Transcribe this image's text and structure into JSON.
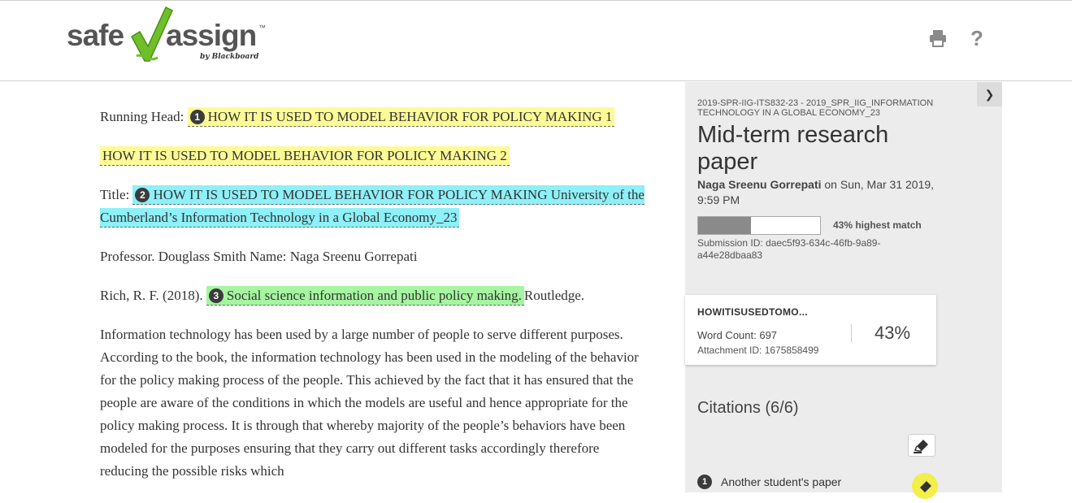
{
  "header": {
    "logo_text_left": "safe",
    "logo_text_right": "assign",
    "logo_tm": "™",
    "logo_sub": "by Blackboard",
    "print_icon": "printer-icon",
    "help_label": "?"
  },
  "document": {
    "line1_prefix": "Running Head:",
    "line1_num": "1",
    "line1_highlight": "HOW IT IS USED TO MODEL BEHAVIOR FOR POLICY MAKING 1",
    "line2_highlight": "HOW IT IS USED TO MODEL BEHAVIOR FOR POLICY MAKING 2",
    "line3_prefix": "Title:",
    "line3_num": "2",
    "line3_highlight": "HOW IT IS USED TO MODEL BEHAVIOR FOR POLICY MAKING University of the Cumberland’s Information Technology in a Global Economy_23",
    "line4": "Professor. Douglass Smith Name: Naga Sreenu Gorrepati",
    "line5_prefix": "Rich, R. F. (2018).",
    "line5_num": "3",
    "line5_highlight": "Social science information and public policy making.",
    "line5_suffix": "Routledge.",
    "body": "Information technology has been used by a large number of people to serve different purposes. According to the book, the information technology has been used in the modeling of the behavior for the policy making process of the people. This achieved by the fact that it has ensured that the people are aware of the conditions in which the models are useful and hence appropriate for the policy making process. It is through that whereby majority of the people’s behaviors have been modeled for the purposes ensuring that they carry out different tasks accordingly therefore reducing the possible risks which"
  },
  "panel": {
    "toggle_icon": "chevron-right-icon",
    "course": "2019-SPR-IIG-ITS832-23 - 2019_SPR_IIG_INFORMATION TECHNOLOGY IN A GLOBAL ECONOMY_23",
    "title": "Mid-term research paper",
    "author": "Naga Sreenu Gorrepati",
    "date": "on Sun, Mar 31 2019, 9:59 PM",
    "match_percent": 43,
    "match_label": "43% highest match",
    "submission_id": "Submission ID: daec5f93-634c-46fb-9a89-a44e28dbaa83"
  },
  "card": {
    "name": "HOWITISUSEDTOMO...",
    "word_count": "Word Count: 697",
    "attachment_id": "Attachment ID: 1675858499",
    "percent": "43%"
  },
  "citations": {
    "heading": "Citations (6/6)",
    "items": [
      {
        "num": "1",
        "label": "Another student's paper",
        "color": "#f2ee4a"
      }
    ]
  },
  "colors": {
    "yellow": "#fdfb96",
    "cyan": "#8ef0f8",
    "green": "#a6f5a1",
    "logo_green": "#6fbf2a"
  }
}
